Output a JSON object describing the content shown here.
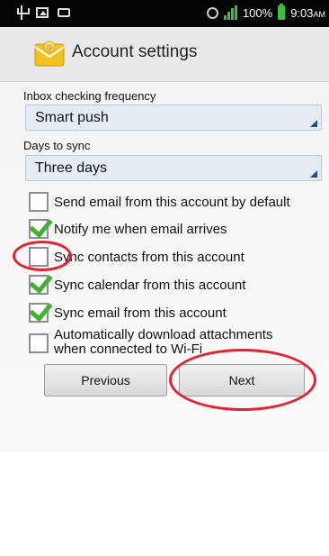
{
  "status_bar": {
    "battery": "100%",
    "time": "9:03",
    "ampm": "AM"
  },
  "header": {
    "title": "Account settings",
    "icon": "email-app-icon"
  },
  "form": {
    "inbox_frequency": {
      "label": "Inbox checking frequency",
      "value": "Smart push"
    },
    "days_to_sync": {
      "label": "Days to sync",
      "value": "Three days"
    },
    "checkboxes": [
      {
        "label": "Send email from this account by default",
        "checked": false
      },
      {
        "label": "Notify me when email arrives",
        "checked": true
      },
      {
        "label": "Sync contacts from this account",
        "checked": false
      },
      {
        "label": "Sync calendar from this account",
        "checked": true
      },
      {
        "label": "Sync email from this account",
        "checked": true
      },
      {
        "label_line1": "Automatically download attachments",
        "label_line2": "when connected to Wi-Fi",
        "checked": false
      }
    ]
  },
  "buttons": {
    "previous": "Previous",
    "next": "Next"
  },
  "colors": {
    "check": "#44b02f",
    "annotation": "#e3232f",
    "select_bg": "#e4ebf2"
  }
}
